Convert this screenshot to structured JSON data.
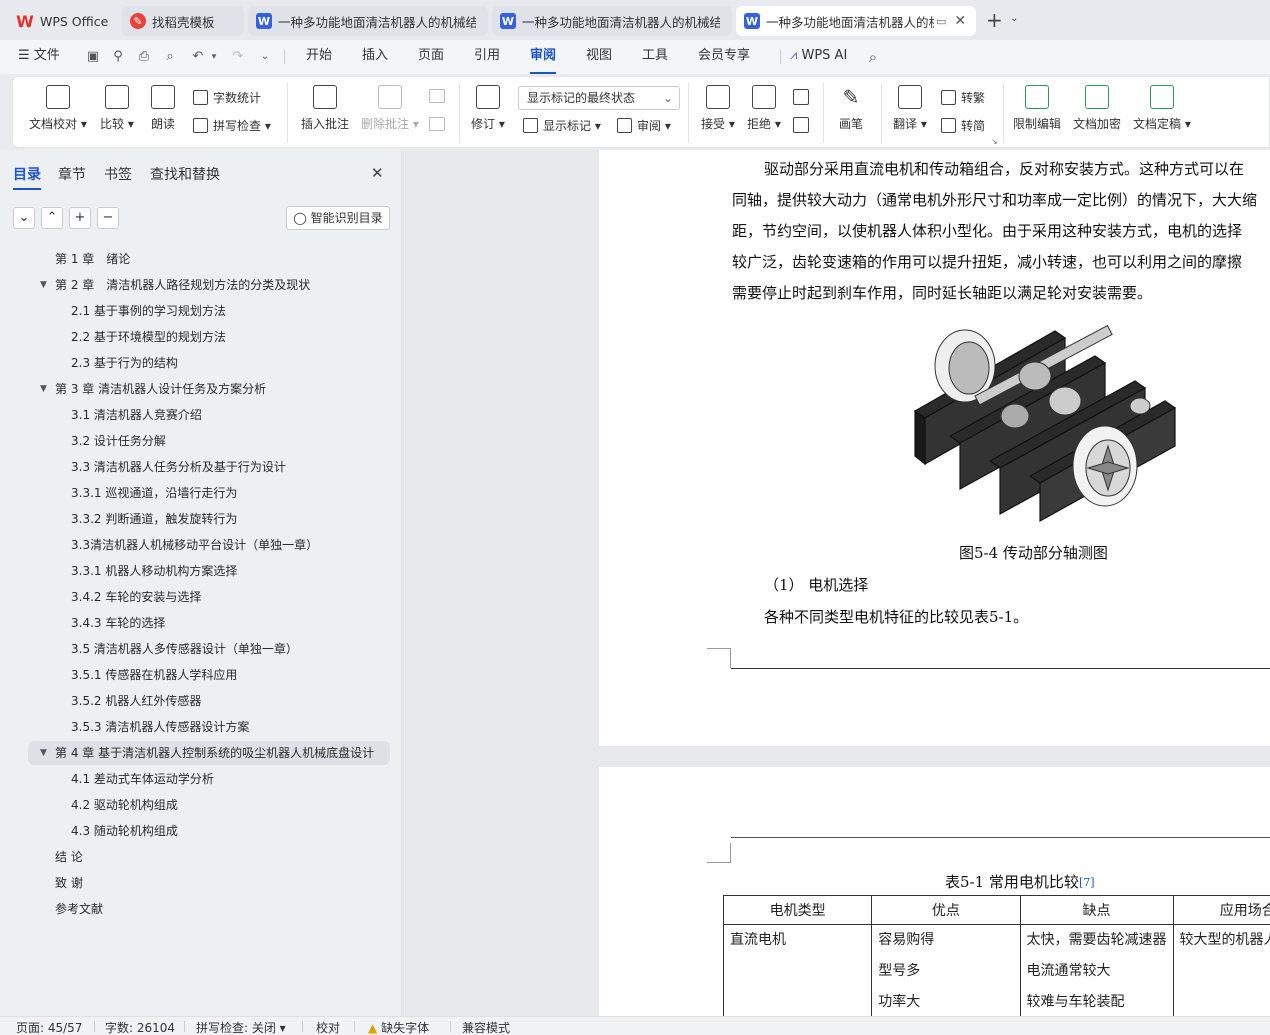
{
  "tabs": [
    {
      "title": "WPS Office",
      "type": "wps-home"
    },
    {
      "title": "找稻壳模板",
      "type": "docer"
    },
    {
      "title": "一种多功能地面清洁机器人的机械结构",
      "type": "doc"
    },
    {
      "title": "一种多功能地面清洁机器人的机械结构",
      "type": "doc"
    },
    {
      "title": "一种多功能地面清洁机器人的机",
      "type": "doc",
      "active": true
    }
  ],
  "menubar": {
    "file": "文件",
    "items": [
      "开始",
      "插入",
      "页面",
      "引用",
      "审阅",
      "视图",
      "工具",
      "会员专享"
    ],
    "active": "审阅",
    "ai": "WPS AI"
  },
  "ribbon": {
    "doc_proof": "文档校对",
    "compare": "比较",
    "read_aloud": "朗读",
    "word_count": "字数统计",
    "spell_check": "拼写检查",
    "insert_comment": "插入批注",
    "delete_comment": "删除批注",
    "track": "修订",
    "markup_state": "显示标记的最终状态",
    "show_markup": "显示标记",
    "review": "审阅",
    "accept": "接受",
    "reject": "拒绝",
    "pen": "画笔",
    "translate": "翻译",
    "simp_to_trad": "转繁",
    "trad_to_simp": "转简",
    "restrict_edit": "限制编辑",
    "doc_encrypt": "文档加密",
    "doc_finalize": "文档定稿"
  },
  "nav": {
    "tabs": [
      "目录",
      "章节",
      "书签",
      "查找和替换"
    ],
    "active_tab": "目录",
    "smart_toc": "智能识别目录",
    "items": [
      {
        "text": "第 1 章　绪论",
        "level": 1,
        "caret": false
      },
      {
        "text": "第 2 章　清洁机器人路径规划方法的分类及现状",
        "level": 1,
        "caret": true
      },
      {
        "text": "2.1  基于事例的学习规划方法",
        "level": 2
      },
      {
        "text": "2.2  基于环境模型的规划方法",
        "level": 2
      },
      {
        "text": "2.3  基于行为的结构",
        "level": 2
      },
      {
        "text": "第 3 章  清洁机器人设计任务及方案分析",
        "level": 1,
        "caret": true
      },
      {
        "text": "3.1  清洁机器人竞赛介绍",
        "level": 2
      },
      {
        "text": "3.2  设计任务分解",
        "level": 2
      },
      {
        "text": "3.3  清洁机器人任务分析及基于行为设计",
        "level": 2
      },
      {
        "text": "3.3.1  巡视通道，沿墙行走行为",
        "level": 2
      },
      {
        "text": "3.3.2  判断通道，触发旋转行为",
        "level": 2
      },
      {
        "text": "3.3清洁机器人机械移动平台设计（单独一章）",
        "level": 2
      },
      {
        "text": "3.3.1  机器人移动机构方案选择",
        "level": 2
      },
      {
        "text": "3.4.2  车轮的安装与选择",
        "level": 2
      },
      {
        "text": "3.4.3  车轮的选择",
        "level": 2
      },
      {
        "text": "3.5  清洁机器人多传感器设计（单独一章）",
        "level": 2
      },
      {
        "text": "3.5.1  传感器在机器人学科应用",
        "level": 2
      },
      {
        "text": "3.5.2  机器人红外传感器",
        "level": 2
      },
      {
        "text": "3.5.3 清洁机器人传感器设计方案",
        "level": 2
      },
      {
        "text": "第 4 章  基于清洁机器人控制系统的吸尘机器人机械底盘设计",
        "level": 1,
        "caret": true,
        "selected": true
      },
      {
        "text": "4.1 差动式车体运动学分析",
        "level": 2
      },
      {
        "text": "4.2  驱动轮机构组成",
        "level": 2
      },
      {
        "text": "4.3  随动轮机构组成",
        "level": 2
      },
      {
        "text": "结  论",
        "level": 1
      },
      {
        "text": "致  谢",
        "level": 1
      },
      {
        "text": "参考文献",
        "level": 1
      }
    ]
  },
  "document": {
    "paragraph_lines": [
      "驱动部分采用直流电机和传动箱组合，反对称安装方式。这种方式可以在",
      "同轴，提供较大动力（通常电机外形尺寸和功率成一定比例）的情况下，大大缩",
      "距，节约空间，以使机器人体积小型化。由于采用这种安装方式，电机的选择",
      "较广泛，齿轮变速箱的作用可以提升扭矩，减小转速，也可以利用之间的摩擦",
      "需要停止时起到刹车作用，同时延长轴距以满足轮对安装需要。"
    ],
    "figure_caption": "图5-4  传动部分轴测图",
    "section_heading": "（1）  电机选择",
    "intro_line": "各种不同类型电机特征的比较见表5-1。",
    "table_caption": "表5-1  常用电机比较",
    "table_ref": "[7]",
    "table_headers": [
      "电机类型",
      "优点",
      "缺点",
      "应用场合"
    ],
    "table_rows": [
      {
        "type": "直流电机",
        "pros": [
          "容易购得",
          "型号多",
          "功率大"
        ],
        "cons": [
          "太快，需要齿轮减速器",
          "电流通常较大",
          "较难与车轮装配"
        ],
        "use": "较大型的机器人"
      }
    ]
  },
  "status": {
    "page": "页面: 45/57",
    "words": "字数: 26104",
    "spell": "拼写检查: 关闭",
    "proof": "校对",
    "missing_font": "缺失字体",
    "compat": "兼容模式"
  }
}
